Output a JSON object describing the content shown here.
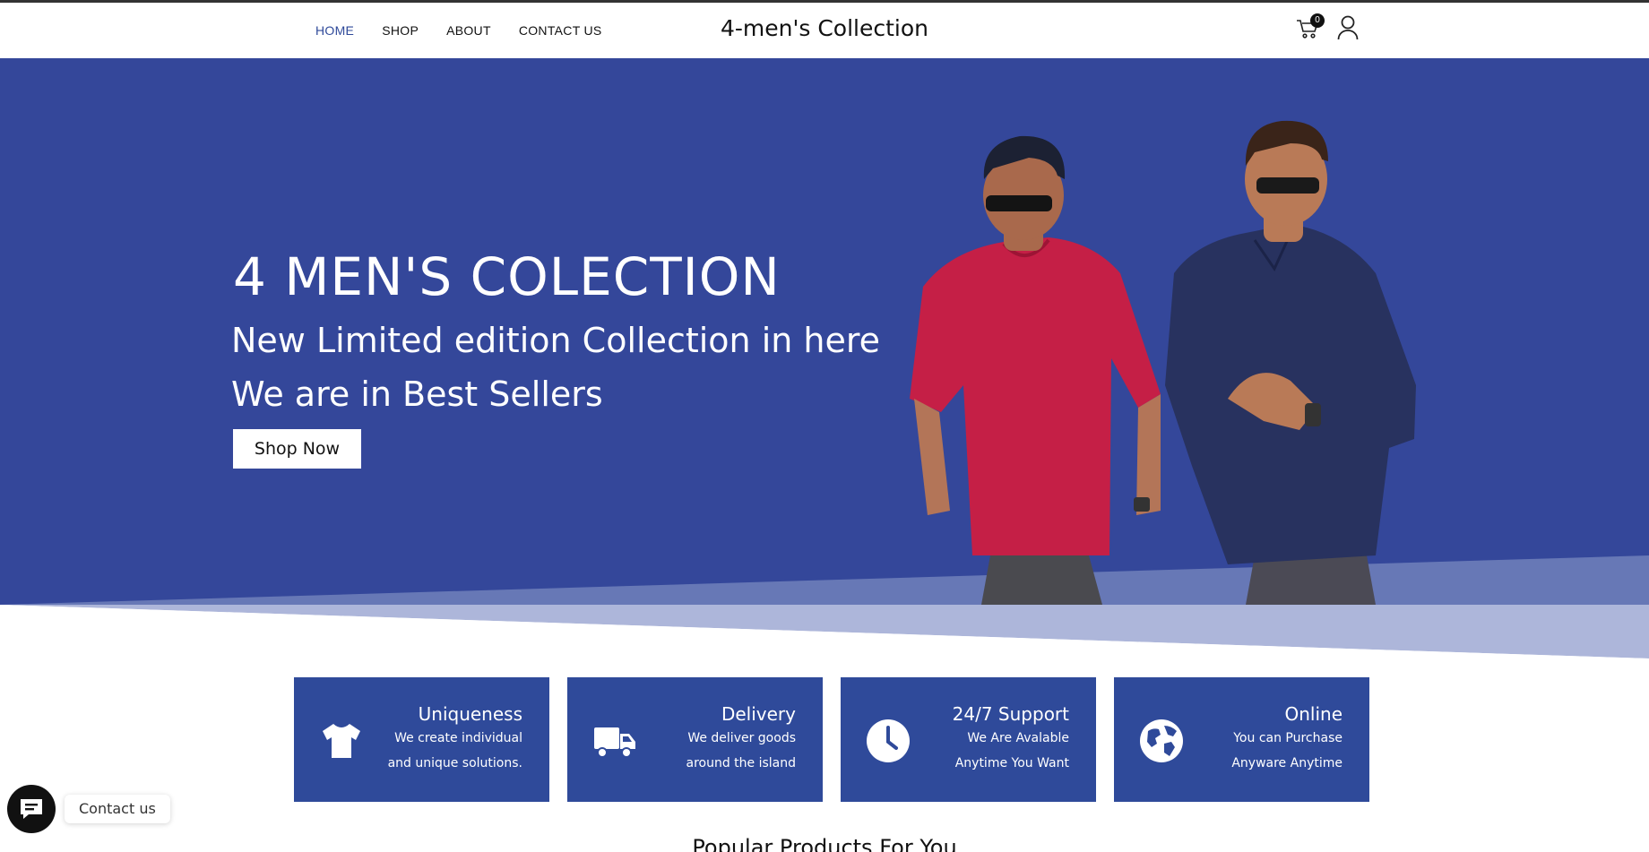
{
  "header": {
    "nav": [
      "HOME",
      "SHOP",
      "ABOUT",
      "CONTACT US"
    ],
    "active_nav": "HOME",
    "brand": "4-men's Collection",
    "cart_count": "0",
    "icons": [
      "cart-icon",
      "user-icon"
    ]
  },
  "hero": {
    "title": "4 MEN'S COLECTION",
    "subtitle_1": "New Limited edition Collection in here",
    "subtitle_2": "We are in Best Sellers",
    "button": "Shop Now",
    "background_color": "#34479a"
  },
  "features": [
    {
      "icon": "tshirt-icon",
      "title": "Uniqueness",
      "line1": "We create individual",
      "line2": "and unique solutions."
    },
    {
      "icon": "truck-icon",
      "title": "Delivery",
      "line1": "We deliver goods",
      "line2": "around the island"
    },
    {
      "icon": "clock-icon",
      "title": "24/7 Support",
      "line1": "We Are Avalable",
      "line2": "Anytime You Want"
    },
    {
      "icon": "globe-icon",
      "title": "Online",
      "line1": "You can Purchase",
      "line2": "Anyware Anytime"
    }
  ],
  "chat": {
    "label": "Contact us",
    "icon": "chat-icon"
  },
  "section_heading": "Popular Products For You",
  "colors": {
    "accent": "#2f4a9a",
    "hero": "#34479a",
    "dark": "#111111"
  }
}
